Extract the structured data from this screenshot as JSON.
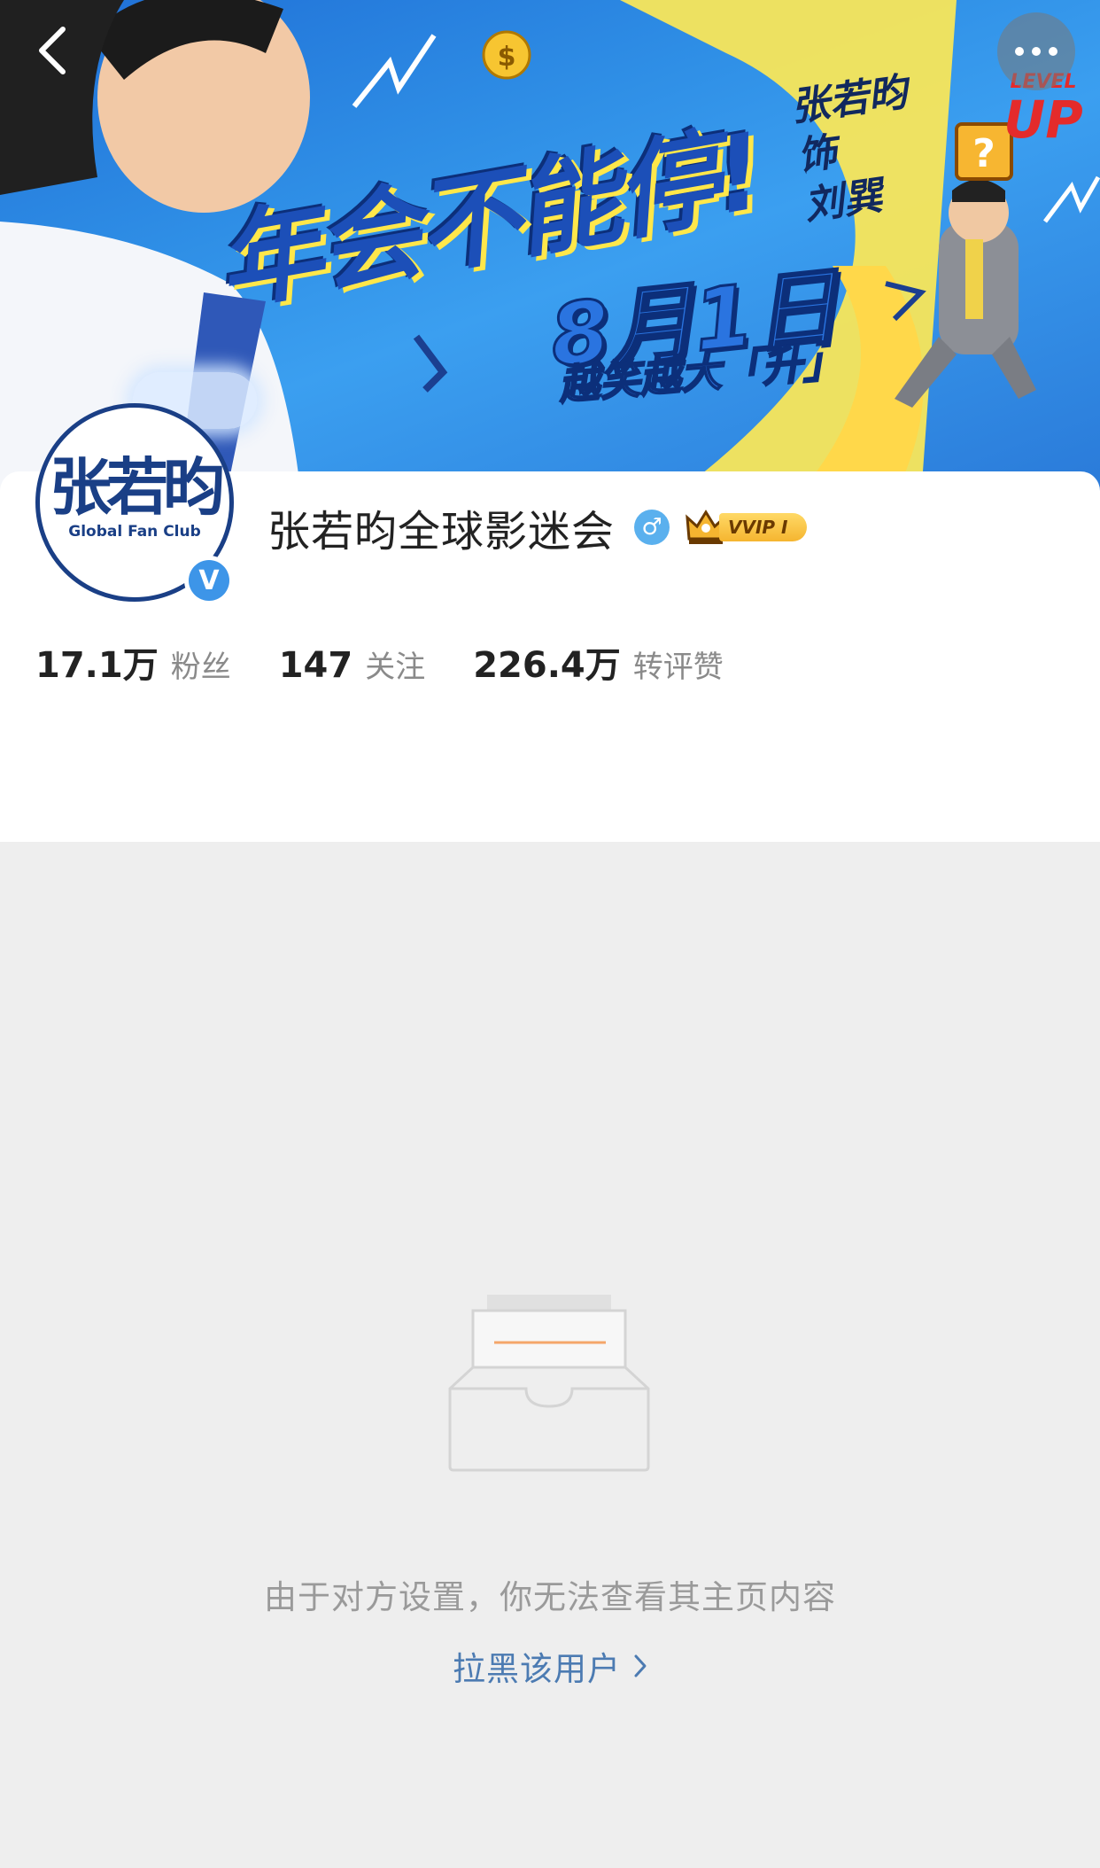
{
  "banner": {
    "title": "年会不能停!",
    "date": "8月1日",
    "slogan": "越笑越大「升」",
    "role_line1": "张若昀",
    "role_line2": "饰",
    "role_line3": "刘巽",
    "level_small": "LEVEL",
    "level_big": "UP"
  },
  "nav": {
    "back_icon": "chevron-left-icon",
    "more_icon": "more-dots-icon"
  },
  "profile": {
    "avatar_logo": "张若昀",
    "avatar_caption": "Global Fan Club",
    "verified_mark": "V",
    "name": "张若昀全球影迷会",
    "gender_symbol": "♂",
    "vip_label": "VVIP Ⅰ",
    "colors": {
      "verify": "#3d95e8",
      "gender": "#5ab0ee",
      "vip": "#f5b530",
      "link": "#4c7bb2"
    }
  },
  "stats": [
    {
      "value": "17.1万",
      "label": "粉丝"
    },
    {
      "value": "147",
      "label": "关注"
    },
    {
      "value": "226.4万",
      "label": "转评赞"
    }
  ],
  "empty_state": {
    "icon": "empty-inbox-icon",
    "message": "由于对方设置，你无法查看其主页内容",
    "block_label": "拉黑该用户",
    "chevron_icon": "chevron-right-icon"
  }
}
